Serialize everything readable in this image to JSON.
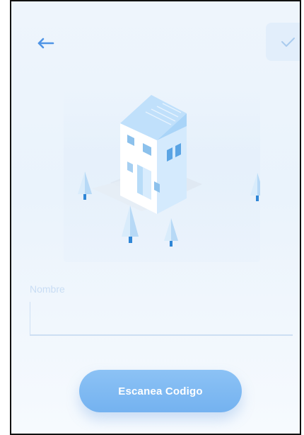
{
  "header": {
    "back_icon": "arrow-left-icon",
    "confirm_icon": "checkmark-icon"
  },
  "illustration": {
    "subject": "house-with-trees-icon"
  },
  "form": {
    "name_label": "Nombre",
    "name_value": "",
    "name_placeholder": ""
  },
  "actions": {
    "scan_label": "Escanea Codigo"
  },
  "colors": {
    "accent": "#74b2f0",
    "background": "#eaf3fc",
    "back_arrow": "#4f94e6",
    "check": "#a9cbee",
    "label": "#c9ddf4"
  }
}
